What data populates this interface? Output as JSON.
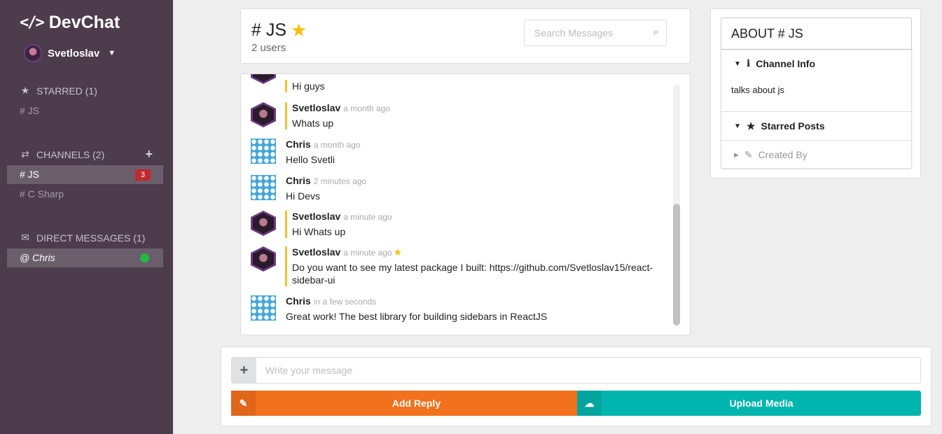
{
  "app": {
    "name": "DevChat"
  },
  "user": {
    "name": "Svetloslav"
  },
  "sidebar": {
    "starred": {
      "label": "STARRED (1)",
      "items": [
        {
          "label": "# JS"
        }
      ]
    },
    "channels": {
      "label": "CHANNELS (2)",
      "items": [
        {
          "label": "# JS",
          "badge": "3",
          "active": true
        },
        {
          "label": "# C Sharp"
        }
      ]
    },
    "direct": {
      "label": "DIRECT MESSAGES (1)",
      "items": [
        {
          "label": "@ Chris",
          "status": "online"
        }
      ]
    }
  },
  "channel": {
    "title": "# JS",
    "users": "2 users",
    "search_placeholder": "Search Messages"
  },
  "messages": [
    {
      "author": "",
      "time": "",
      "text": "Hi guys",
      "own": true
    },
    {
      "author": "Svetloslav",
      "time": "a month ago",
      "text": "Whats up",
      "own": true
    },
    {
      "author": "Chris",
      "time": "a month ago",
      "text": "Hello Svetli",
      "own": false
    },
    {
      "author": "Chris",
      "time": "2 minutes ago",
      "text": "Hi Devs",
      "own": false
    },
    {
      "author": "Svetloslav",
      "time": "a minute ago",
      "text": "Hi Whats up",
      "own": true
    },
    {
      "author": "Svetloslav",
      "time": "a minute ago",
      "text": "Do you want to see my latest package I built: https://github.com/Svetloslav15/react-sidebar-ui",
      "own": true,
      "starred": true
    },
    {
      "author": "Chris",
      "time": "in a few seconds",
      "text": "Great work! The best library for building sidebars in ReactJS",
      "own": false
    }
  ],
  "composer": {
    "placeholder": "Write your message",
    "reply_label": "Add Reply",
    "upload_label": "Upload Media"
  },
  "about": {
    "title": "ABOUT # JS",
    "channel_info_label": "Channel Info",
    "channel_info_text": "talks about js",
    "starred_posts_label": "Starred Posts",
    "created_by_label": "Created By"
  },
  "colors": {
    "sidebar_bg": "#4c3c4c",
    "badge": "#c0292d",
    "online": "#21ba45",
    "star": "#fbbd08",
    "reply_btn": "#f2711c",
    "upload_btn": "#00b5ad",
    "own_message_border": "#f2c037"
  },
  "icons": {
    "brand": "code-icon",
    "starred": "star-icon",
    "channels": "exchange-icon",
    "direct": "mail-icon",
    "add_channel": "plus-icon",
    "search": "search-icon",
    "channel_info": "info-icon",
    "starred_posts": "star-icon",
    "created_by": "pencil-icon",
    "reply": "edit-icon",
    "upload": "cloud-upload-icon"
  }
}
